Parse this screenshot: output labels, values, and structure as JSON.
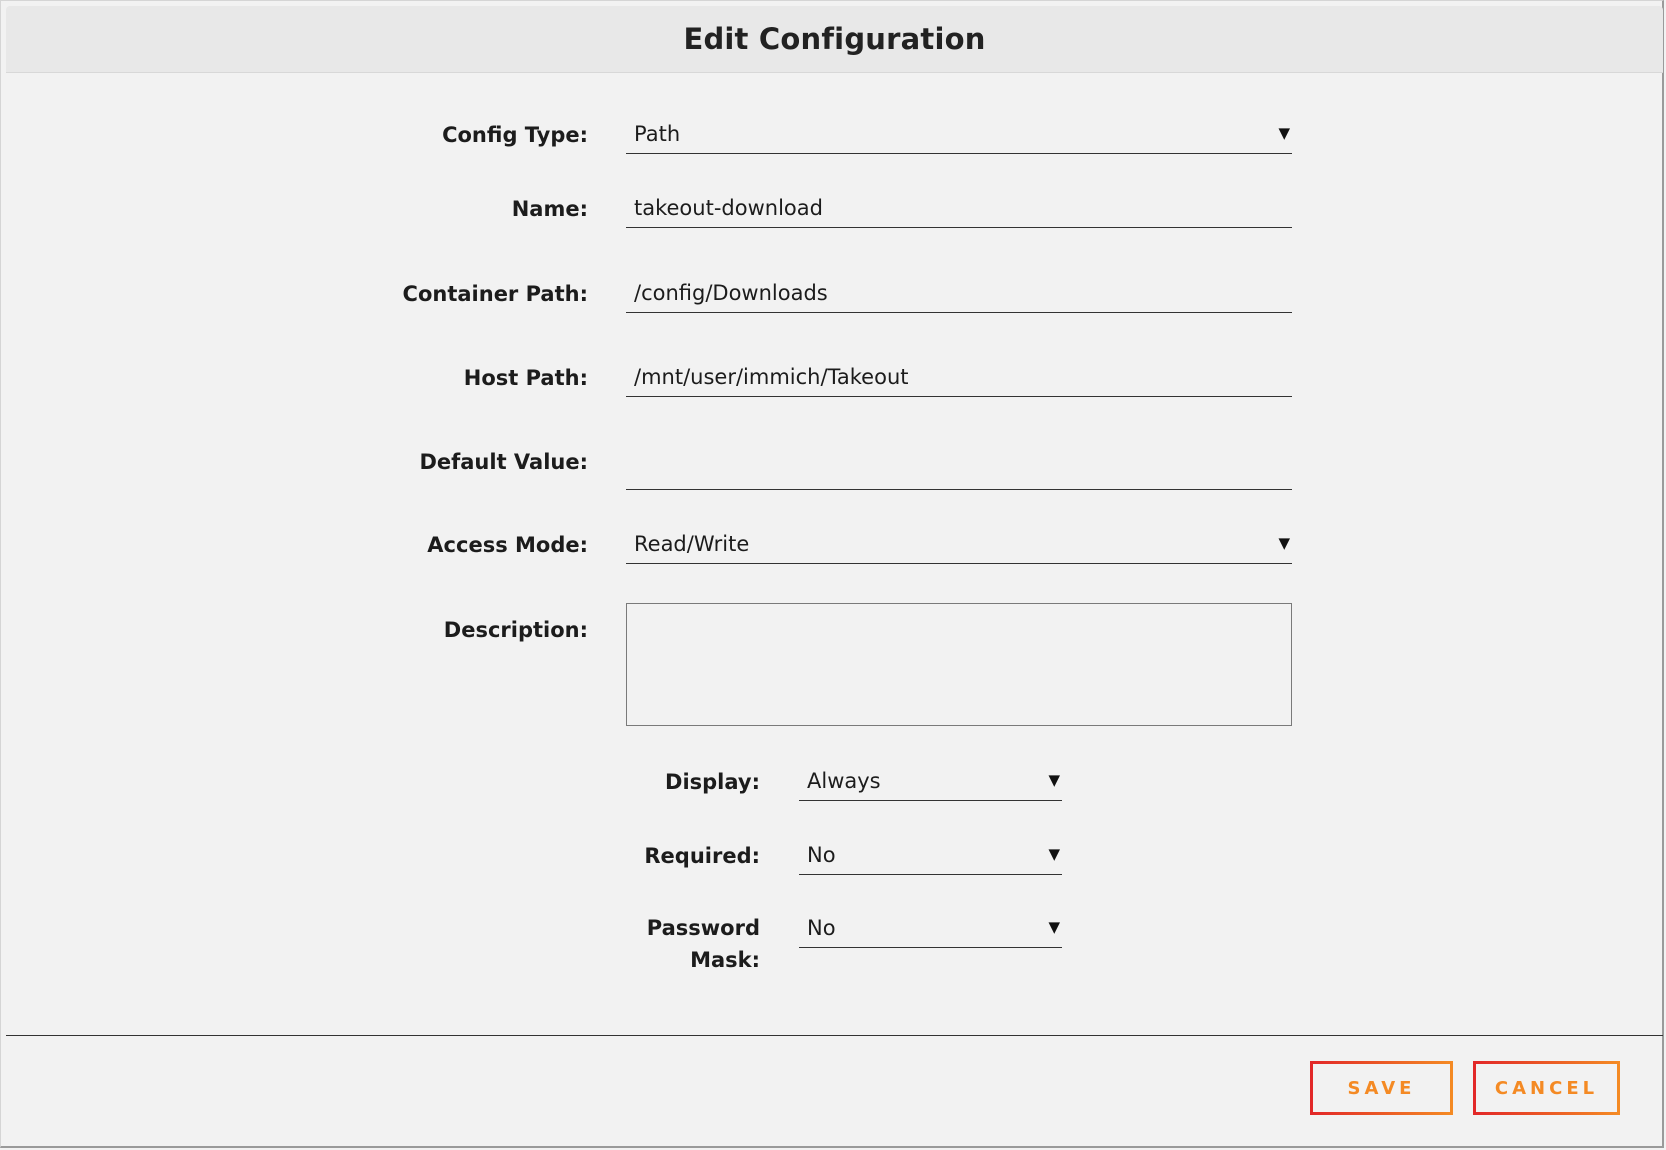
{
  "dialog": {
    "title": "Edit Configuration"
  },
  "fields": {
    "config_type": {
      "label": "Config Type:",
      "value": "Path"
    },
    "name": {
      "label": "Name:",
      "value": "takeout-download"
    },
    "container_path": {
      "label": "Container Path:",
      "value": "/config/Downloads"
    },
    "host_path": {
      "label": "Host Path:",
      "value": "/mnt/user/immich/Takeout"
    },
    "default_value": {
      "label": "Default Value:",
      "value": ""
    },
    "access_mode": {
      "label": "Access Mode:",
      "value": "Read/Write"
    },
    "description": {
      "label": "Description:",
      "value": ""
    },
    "display": {
      "label": "Display:",
      "value": "Always"
    },
    "required": {
      "label": "Required:",
      "value": "No"
    },
    "password_mask": {
      "label_line1": "Password",
      "label_line2": "Mask:",
      "value": "No"
    }
  },
  "icons": {
    "dropdown": "▼"
  },
  "buttons": {
    "save": "SAVE",
    "cancel": "CANCEL"
  },
  "colors": {
    "accent_orange": "#f48a24",
    "accent_red": "#e22828",
    "background": "#f2f2f2",
    "header_bg": "#e8e8e8"
  }
}
